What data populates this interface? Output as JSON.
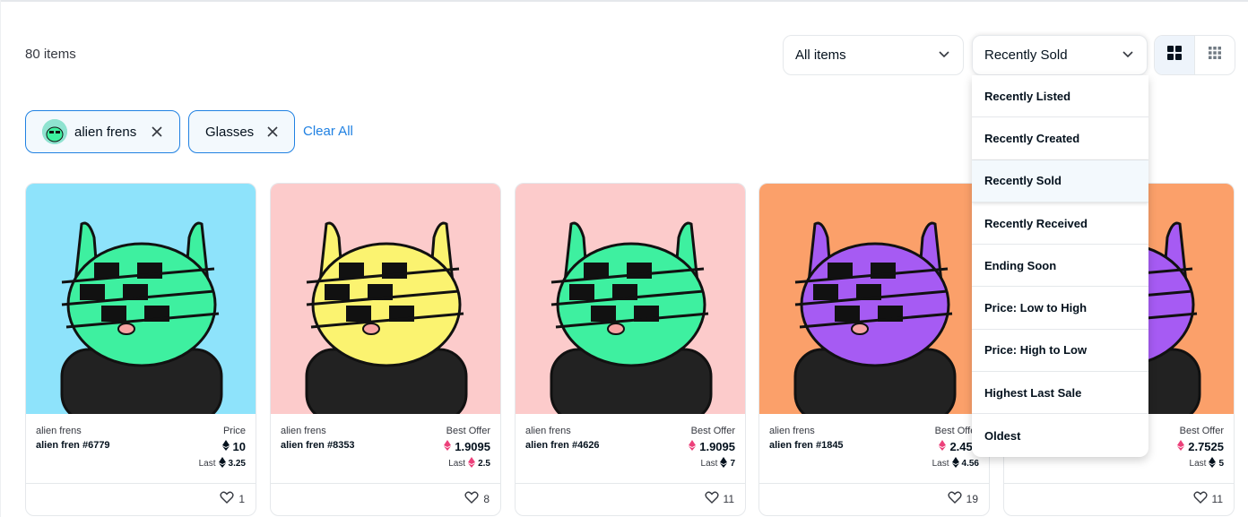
{
  "results": {
    "count_label": "80 items"
  },
  "filters": {
    "items_select": "All items",
    "sort_select": "Recently Sold",
    "chips": [
      {
        "label": "alien frens",
        "icon": "collection-avatar"
      },
      {
        "label": "Glasses"
      }
    ],
    "clear_all": "Clear All"
  },
  "view_modes": [
    "large-grid-icon",
    "small-grid-icon"
  ],
  "sort_menu": {
    "items": [
      "Recently Listed",
      "Recently Created",
      "Recently Sold",
      "Recently Received",
      "Ending Soon",
      "Price: Low to High",
      "Price: High to Low",
      "Highest Last Sale",
      "Oldest"
    ],
    "selected": "Recently Sold"
  },
  "cards": [
    {
      "collection": "alien frens",
      "name": "alien fren #6779",
      "price_label": "Price",
      "price": "10",
      "price_currency": "eth-black",
      "last_label": "Last",
      "last": "3.25",
      "last_currency": "eth-black",
      "likes": "1",
      "bg": "#8ee3fb",
      "skin": "#3ef0a0"
    },
    {
      "collection": "alien frens",
      "name": "alien fren #8353",
      "price_label": "Best Offer",
      "price": "1.9095",
      "price_currency": "weth-pink",
      "last_label": "Last",
      "last": "2.5",
      "last_currency": "weth-pink",
      "likes": "8",
      "bg": "#fccbcb",
      "skin": "#fbf370"
    },
    {
      "collection": "alien frens",
      "name": "alien fren #4626",
      "price_label": "Best Offer",
      "price": "1.9095",
      "price_currency": "weth-pink",
      "last_label": "Last",
      "last": "7",
      "last_currency": "eth-black",
      "likes": "11",
      "bg": "#fccbcb",
      "skin": "#3ef0a0"
    },
    {
      "collection": "alien frens",
      "name": "alien fren #1845",
      "price_label": "Best Offer",
      "price": "2.452",
      "price_currency": "weth-pink",
      "last_label": "Last",
      "last": "4.56",
      "last_currency": "eth-black",
      "likes": "19",
      "bg": "#fba06a",
      "skin": "#a65bf3"
    },
    {
      "collection": "",
      "name": "",
      "price_label": "Best Offer",
      "price": "2.7525",
      "price_currency": "weth-pink",
      "last_label": "Last",
      "last": "5",
      "last_currency": "eth-black",
      "likes": "11",
      "bg": "#fba06a",
      "skin": "#a65bf3"
    }
  ],
  "colors": {
    "accent": "#2081e2",
    "border": "#e5e8eb",
    "weth": "#ec407a"
  }
}
